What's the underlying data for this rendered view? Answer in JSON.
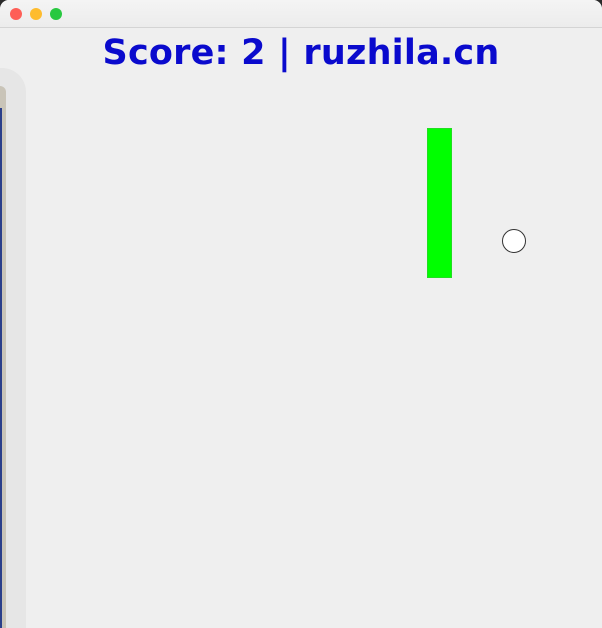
{
  "window": {
    "controls": {
      "close_color": "#fe5f57",
      "minimize_color": "#febc2e",
      "zoom_color": "#28c840"
    }
  },
  "game": {
    "score_text": "Score: 2 | ruzhila.cn",
    "score_color": "#0a0acd",
    "background_color": "#efefef",
    "paddle_color": "#00ff00",
    "ball_color": "#ffffff"
  }
}
